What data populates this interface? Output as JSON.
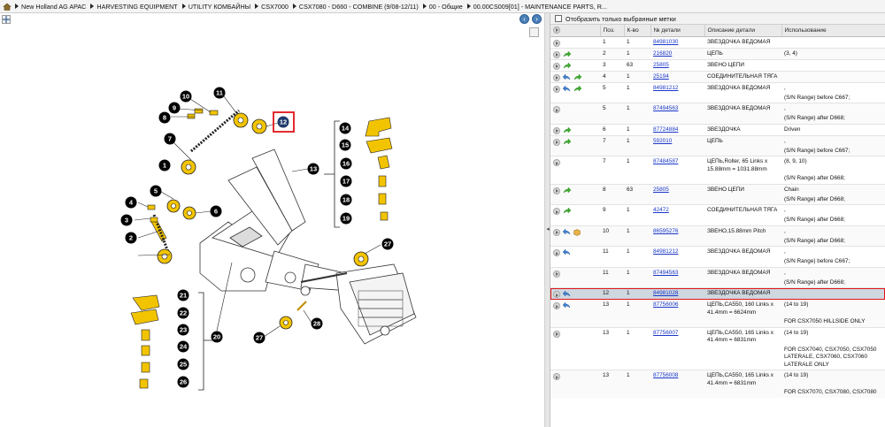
{
  "breadcrumb": [
    "New Holland AG APAC",
    "HARVESTING EQUIPMENT",
    "UTILITY КОМБАЙНЫ",
    "CSX7000",
    "CSX7080 - D660 - COMBINE (9/08-12/11)",
    "00 - Общие",
    "00.00CS009[01] - MAINTENANCE PARTS, R..."
  ],
  "filter": {
    "label": "Отобразить только выбранные метки",
    "checked": false
  },
  "table": {
    "columns": [
      "",
      "Поз.",
      "К-во",
      "№ детали",
      "Описание детали",
      "Использование"
    ],
    "rows": [
      {
        "icons": [
          "info"
        ],
        "pos": "1",
        "qty": "1",
        "part": "84981030",
        "desc": "ЗВЕЗДОЧКА ВЕДОМАЯ",
        "usage": ""
      },
      {
        "icons": [
          "info",
          "green"
        ],
        "pos": "2",
        "qty": "1",
        "part": "216820",
        "desc": "ЦЕПЬ",
        "usage": "(3, 4)"
      },
      {
        "icons": [
          "info",
          "green"
        ],
        "pos": "3",
        "qty": "63",
        "part": "25805",
        "desc": "ЗВЕНО ЦЕПИ",
        "usage": ""
      },
      {
        "icons": [
          "info",
          "blue",
          "green"
        ],
        "pos": "4",
        "qty": "1",
        "part": "25194",
        "desc": "СОЕДИНИТЕЛЬНАЯ ТЯГА",
        "usage": ""
      },
      {
        "icons": [
          "info",
          "blue",
          "green"
        ],
        "pos": "5",
        "qty": "1",
        "part": "84981212",
        "desc": "ЗВЕЗДОЧКА ВЕДОМАЯ",
        "usage": ",",
        "extra": [
          "(S/N Range) before C667;"
        ]
      },
      {
        "icons": [
          "info"
        ],
        "pos": "5",
        "qty": "1",
        "part": "87494563",
        "desc": "ЗВЕЗДОЧКА ВЕДОМАЯ",
        "usage": ",",
        "extra": [
          "(S/N Range) after D668;"
        ]
      },
      {
        "icons": [
          "info",
          "green"
        ],
        "pos": "6",
        "qty": "1",
        "part": "87724884",
        "desc": "ЗВЕЗДОЧКА",
        "usage": "Driven"
      },
      {
        "icons": [
          "info",
          "green"
        ],
        "pos": "7",
        "qty": "1",
        "part": "592010",
        "desc": "ЦЕПЬ",
        "usage": ",",
        "extra": [
          "(S/N Range) before C667;"
        ]
      },
      {
        "icons": [
          "info"
        ],
        "pos": "7",
        "qty": "1",
        "part": "87484587",
        "desc": "ЦЕПЬ,Roller, 65 Links x 15.88mm = 1031.88mm",
        "usage": "(8, 9, 10)",
        "extra": [
          "(S/N Range) after D668;"
        ]
      },
      {
        "icons": [
          "info",
          "green"
        ],
        "pos": "8",
        "qty": "63",
        "part": "25805",
        "desc": "ЗВЕНО ЦЕПИ",
        "usage": "Chain",
        "extra": [
          "(S/N Range) after D668;"
        ]
      },
      {
        "icons": [
          "info",
          "green"
        ],
        "pos": "9",
        "qty": "1",
        "part": "42472",
        "desc": "СОЕДИНИТЕЛЬНАЯ ТЯГА",
        "usage": ",",
        "extra": [
          "(S/N Range) after D668;"
        ]
      },
      {
        "icons": [
          "info",
          "blue",
          "box"
        ],
        "pos": "10",
        "qty": "1",
        "part": "86595276",
        "desc": "ЗВЕНО,15.88mm Pitch",
        "usage": ",",
        "extra": [
          "(S/N Range) after D668;"
        ]
      },
      {
        "icons": [
          "info",
          "blue"
        ],
        "pos": "11",
        "qty": "1",
        "part": "84981212",
        "desc": "ЗВЕЗДОЧКА ВЕДОМАЯ",
        "usage": ",",
        "extra": [
          "(S/N Range) before C667;"
        ]
      },
      {
        "icons": [
          "info"
        ],
        "pos": "11",
        "qty": "1",
        "part": "87494563",
        "desc": "ЗВЕЗДОЧКА ВЕДОМАЯ",
        "usage": ",",
        "extra": [
          "(S/N Range) after D668;"
        ]
      },
      {
        "icons": [
          "info",
          "blue"
        ],
        "pos": "12",
        "qty": "1",
        "part": "84981028",
        "desc": "ЗВЕЗДОЧКА ВЕДОМАЯ",
        "usage": "",
        "selected": true
      },
      {
        "icons": [
          "info",
          "blue"
        ],
        "pos": "13",
        "qty": "1",
        "part": "87756006",
        "desc": "ЦЕПЬ,CA550, 160 Links x 41.4mm = 6624mm",
        "usage": "(14 to 19)",
        "extra": [
          "FOR CSX7050 HILLSIDE ONLY"
        ]
      },
      {
        "icons": [
          "info"
        ],
        "pos": "13",
        "qty": "1",
        "part": "87756007",
        "desc": "ЦЕПЬ,CA550, 165 Links x 41.4mm = 6831mm",
        "usage": "(14 to 19)",
        "extra": [
          "FOR CSX7040, CSX7050, CSX7050 LATERALE, CSX7060, CSX7060 LATERALE ONLY"
        ]
      },
      {
        "icons": [
          "info"
        ],
        "pos": "13",
        "qty": "1",
        "part": "87756008",
        "desc": "ЦЕПЬ,CA550, 165 Links x 41.4mm = 6831mm",
        "usage": "(14 to 19)",
        "extra": [
          "FOR CSX7070, CSX7080, CSX7080"
        ]
      }
    ]
  },
  "drawing": {
    "callouts": [
      "1",
      "2",
      "3",
      "4",
      "5",
      "6",
      "7",
      "8",
      "9",
      "10",
      "11",
      "12",
      "13",
      "14",
      "15",
      "16",
      "17",
      "18",
      "19",
      "20",
      "21",
      "22",
      "23",
      "24",
      "25",
      "26",
      "27",
      "27",
      "28"
    ],
    "highlighted_callout": "12"
  },
  "colors": {
    "accent": "#e0151a",
    "link": "#1a37c9",
    "part_yellow": "#f2c400",
    "selected_row": "#cfd7df"
  }
}
